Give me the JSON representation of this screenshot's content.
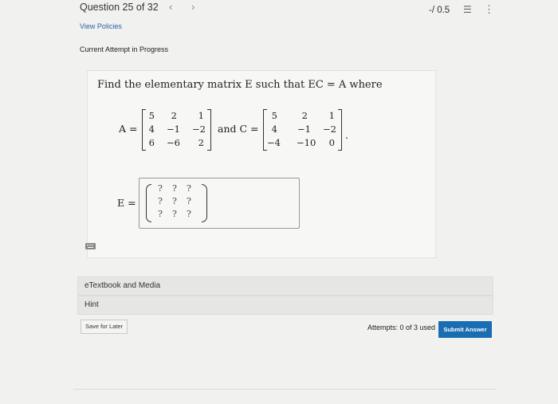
{
  "header": {
    "question_label": "Question 25 of 32",
    "prev_arrow": "‹",
    "next_arrow": "›",
    "score": "-/ 0.5",
    "list_icon": "list-icon",
    "more_icon": "more-vertical-icon"
  },
  "links": {
    "view_policies": "View Policies"
  },
  "attempt_status": "Current Attempt in Progress",
  "question": {
    "prompt": "Find the elementary matrix E such that EC = A where",
    "label_A": "A =",
    "matrix_A": [
      [
        "5",
        "2",
        "1"
      ],
      [
        "4",
        "−1",
        "−2"
      ],
      [
        "6",
        "−6",
        "2"
      ]
    ],
    "connector": "and C =",
    "matrix_C": [
      [
        "5",
        "2",
        "1"
      ],
      [
        "4",
        "−1",
        "−2"
      ],
      [
        "−4",
        "−10",
        "0"
      ]
    ],
    "end_punct": ".",
    "answer_label": "E =",
    "answer_matrix": [
      [
        "?",
        "?",
        "?"
      ],
      [
        "?",
        "?",
        "?"
      ],
      [
        "?",
        "?",
        "?"
      ]
    ]
  },
  "resources": {
    "etextbook": "eTextbook and Media",
    "hint": "Hint"
  },
  "footer": {
    "save_later": "Save for Later",
    "attempts": "Attempts: 0 of 3 used",
    "submit": "Submit Answer"
  },
  "colors": {
    "submit_bg": "#1a6cb3",
    "link": "#2e5fa8"
  }
}
